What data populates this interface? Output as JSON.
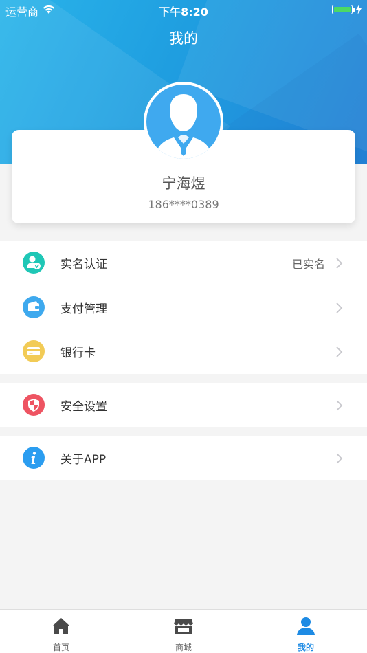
{
  "status_bar": {
    "carrier": "运营商",
    "time": "下午8:20",
    "battery_level": 1.0
  },
  "header": {
    "title": "我的"
  },
  "profile": {
    "name": "宁海煜",
    "phone": "186****0389",
    "avatar_icon": "user-avatar-icon"
  },
  "menu": {
    "group1": [
      {
        "label": "实名认证",
        "value": "已实名",
        "icon": "verified-user-icon",
        "color": "#1fc7b6"
      },
      {
        "label": "支付管理",
        "value": "",
        "icon": "wallet-icon",
        "color": "#3ea9ee"
      },
      {
        "label": "银行卡",
        "value": "",
        "icon": "bank-card-icon",
        "color": "#f2cb56"
      }
    ],
    "group2": [
      {
        "label": "安全设置",
        "value": "",
        "icon": "shield-icon",
        "color": "#ee5462"
      }
    ],
    "group3": [
      {
        "label": "关于APP",
        "value": "",
        "icon": "info-icon",
        "color": "#2b9df0"
      }
    ]
  },
  "tab_bar": {
    "tabs": [
      {
        "label": "首页",
        "icon": "home-icon",
        "active": false
      },
      {
        "label": "商城",
        "icon": "store-icon",
        "active": false
      },
      {
        "label": "我的",
        "icon": "user-icon",
        "active": true
      }
    ],
    "active_color": "#1e8be4",
    "inactive_color": "#4a4a4a"
  }
}
